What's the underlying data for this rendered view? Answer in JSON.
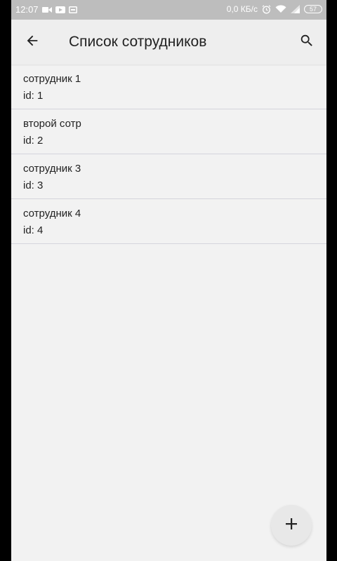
{
  "status_bar": {
    "time": "12:07",
    "network_speed": "0,0 КБ/с",
    "battery_level": "57",
    "icons": [
      "video-camera-icon",
      "youtube-icon",
      "screen-icon",
      "alarm-icon",
      "wifi-icon",
      "signal-icon",
      "battery-icon"
    ]
  },
  "toolbar": {
    "title": "Список сотрудников",
    "back_icon": "arrow-back-icon",
    "search_icon": "search-icon"
  },
  "employees": [
    {
      "name": "сотрудник 1",
      "id_text": "id: 1"
    },
    {
      "name": "второй сотр",
      "id_text": "id: 2"
    },
    {
      "name": "сотрудник 3",
      "id_text": "id: 3"
    },
    {
      "name": "сотрудник 4",
      "id_text": "id: 4"
    }
  ],
  "fab": {
    "icon": "plus-icon"
  },
  "colors": {
    "background": "#f2f2f2",
    "toolbar": "#eeeeee",
    "status_bar": "#bdbdbd",
    "divider": "#d4d4dc",
    "text": "#222222"
  }
}
